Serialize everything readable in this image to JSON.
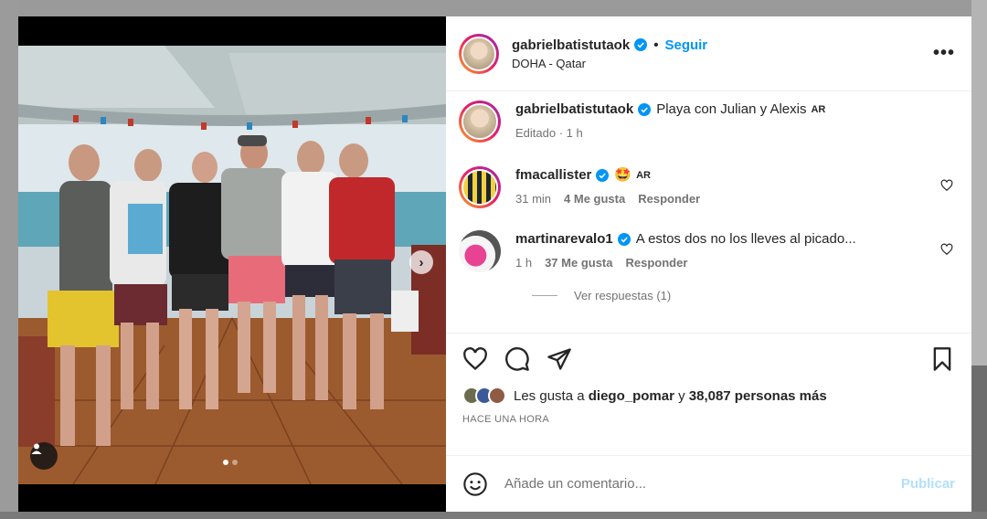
{
  "post": {
    "author": "gabrielbatistutaok",
    "follow_label": "Seguir",
    "location": "DOHA - Qatar",
    "more_label": "•••",
    "caption": "Playa con Julian y Alexis",
    "caption_ar": "AR",
    "caption_meta": "Editado · 1 h"
  },
  "comments": [
    {
      "username": "fmacallister",
      "text": "🤩",
      "ar": "AR",
      "time": "31 min",
      "likes": "4 Me gusta",
      "reply": "Responder"
    },
    {
      "username": "martinarevalo1",
      "text": "A estos dos no los lleves al picado...",
      "time": "1 h",
      "likes": "37 Me gusta",
      "reply": "Responder",
      "view_replies": "Ver respuestas (1)"
    }
  ],
  "likes": {
    "prefix": "Les gusta a",
    "user": "diego_pomar",
    "connector": "y",
    "others": "38,087 personas más"
  },
  "time_ago": "HACE UNA HORA",
  "composer": {
    "placeholder": "Añade un comentario...",
    "publish": "Publicar"
  },
  "icons": [
    "heart-icon",
    "comment-icon",
    "share-icon",
    "bookmark-icon",
    "emoji-icon",
    "verified-icon",
    "tag-user-icon",
    "chevron-right-icon"
  ],
  "colors": {
    "link_blue": "#0095f6",
    "publish_disabled": "#b2dffc",
    "verified": "#0095f6"
  }
}
